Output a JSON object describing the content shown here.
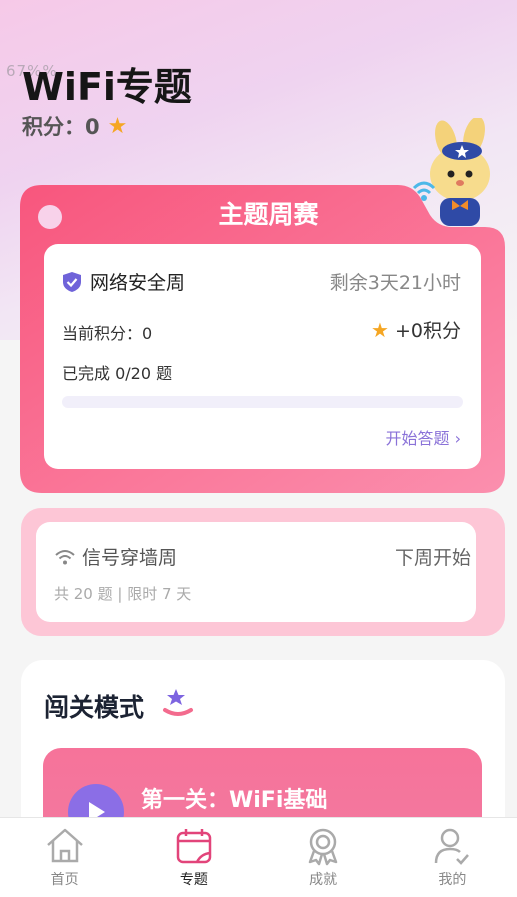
{
  "header": {
    "ghost_text": "67%%",
    "title": "WiFi专题",
    "score_label": "积分：0"
  },
  "weekly": {
    "section_title": "主题周赛",
    "topic_name": "网络安全周",
    "time_remaining": "剩余3天21小时",
    "current_score": "当前积分：0",
    "bonus_score": "+0积分",
    "completed": "已完成 0/20 题",
    "progress": 0,
    "start_link": "开始答题 ›"
  },
  "next_week": {
    "topic_name": "信号穿墙周",
    "status": "下周开始",
    "meta": "共 20 题 | 限时 7 天"
  },
  "challenge": {
    "title": "闯关模式",
    "level_title": "第一关：WiFi基础"
  },
  "tabbar": {
    "items": [
      {
        "label": "首页",
        "icon": "home-icon"
      },
      {
        "label": "专题",
        "icon": "calendar-icon"
      },
      {
        "label": "成就",
        "icon": "medal-icon"
      },
      {
        "label": "我的",
        "icon": "user-icon"
      }
    ],
    "active_index": 1
  },
  "colors": {
    "accent_pink": "#f35f85",
    "accent_purple": "#8b6ee6",
    "star": "#f5a623"
  }
}
